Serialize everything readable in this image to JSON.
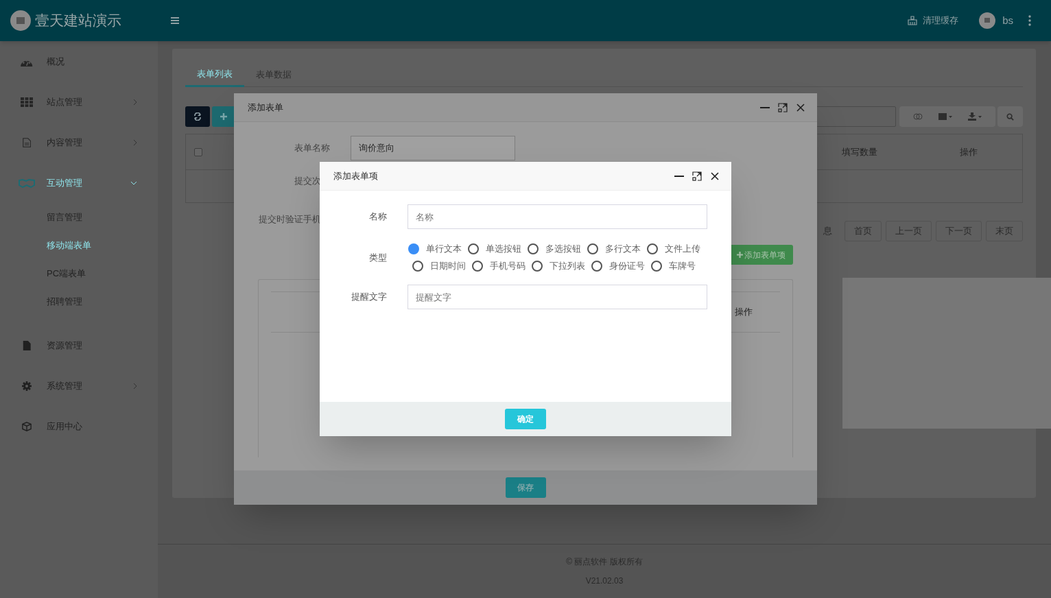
{
  "header": {
    "site_title": "壹天建站演示",
    "clear_cache": "清理缓存",
    "user": "bs"
  },
  "sidebar": {
    "items": [
      {
        "label": "概况",
        "selected": false
      },
      {
        "label": "站点管理",
        "expanded": false,
        "selected": false
      },
      {
        "label": "内容管理",
        "expanded": false,
        "selected": false
      },
      {
        "label": "互动管理",
        "expanded": true,
        "selected": true,
        "children": [
          {
            "label": "留言管理",
            "selected": false
          },
          {
            "label": "移动端表单",
            "selected": true
          },
          {
            "label": "PC端表单",
            "selected": false
          },
          {
            "label": "招聘管理",
            "selected": false
          }
        ]
      },
      {
        "label": "资源管理",
        "selected": false
      },
      {
        "label": "系统管理",
        "expanded": false,
        "selected": false
      },
      {
        "label": "应用中心",
        "selected": false
      }
    ]
  },
  "main": {
    "tabs": [
      {
        "label": "表单列表",
        "selected": true
      },
      {
        "label": "表单数据",
        "selected": false
      }
    ],
    "table": {
      "select_all_checked": false,
      "columns": [
        "填写数量",
        "操作"
      ]
    },
    "pagination": {
      "info": "息",
      "buttons": [
        "首页",
        "上一页",
        "下一页",
        "末页"
      ]
    }
  },
  "form_dialog": {
    "title": "添加表单",
    "fields": [
      {
        "label": "表单名称",
        "value": "询价意向"
      }
    ],
    "partial_labels": [
      "提交次",
      "提交时验证手机"
    ],
    "add_item_button": "添加表单项",
    "items_table": {
      "columns": [
        "操作"
      ]
    },
    "save_button": "保存"
  },
  "item_dialog": {
    "title": "添加表单项",
    "name_field": {
      "label": "名称",
      "placeholder": "名称"
    },
    "type_field": {
      "label": "类型",
      "options": [
        {
          "label": "单行文本",
          "selected": true
        },
        {
          "label": "单选按钮",
          "selected": false
        },
        {
          "label": "多选按钮",
          "selected": false
        },
        {
          "label": "多行文本",
          "selected": false
        },
        {
          "label": "文件上传",
          "selected": false
        },
        {
          "label": "日期时间",
          "selected": false
        },
        {
          "label": "手机号码",
          "selected": false
        },
        {
          "label": "下拉列表",
          "selected": false
        },
        {
          "label": "身份证号",
          "selected": false
        },
        {
          "label": "车牌号",
          "selected": false
        }
      ]
    },
    "hint_field": {
      "label": "提醒文字",
      "placeholder": "提醒文字"
    },
    "confirm_button": "确定"
  },
  "footer": {
    "copyright": "© 丽点软件 版权所有",
    "version": "V21.02.03"
  }
}
